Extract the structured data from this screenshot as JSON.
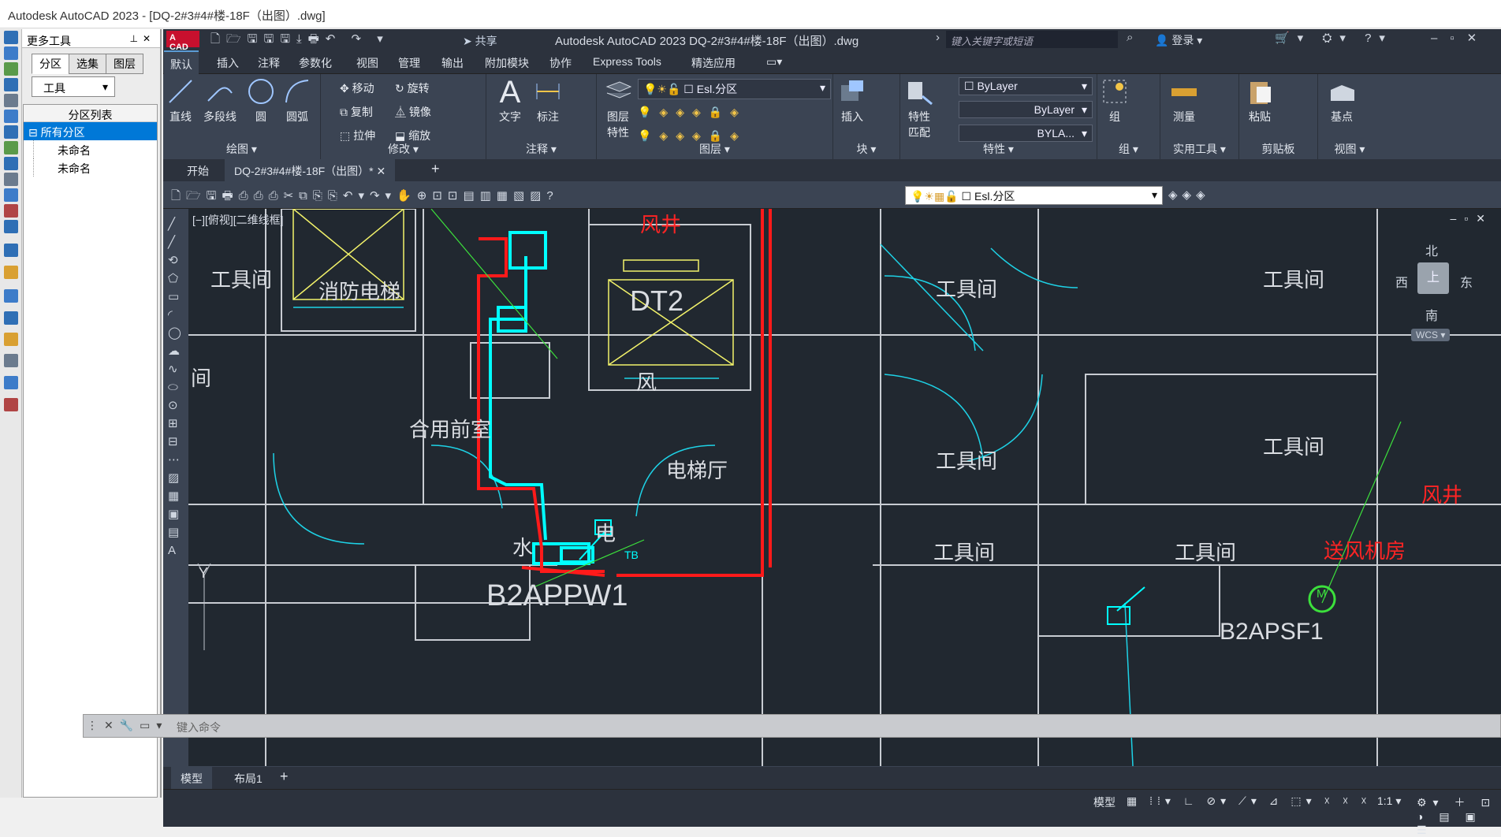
{
  "window": {
    "title": "Autodesk AutoCAD 2023 - [DQ-2#3#4#楼-18F（出图）.dwg]"
  },
  "palette": {
    "title": "更多工具",
    "tabs": [
      "分区",
      "选集",
      "图层"
    ],
    "dropdown": "工具",
    "list_header": "分区列表",
    "items": [
      "所有分区",
      "未命名",
      "未命名"
    ]
  },
  "qat": {
    "logo": "A CAD",
    "share": "共享",
    "title": "Autodesk AutoCAD 2023    DQ-2#3#4#楼-18F（出图）.dwg",
    "search_placeholder": "键入关键字或短语",
    "login": "登录"
  },
  "ribbon_tabs": [
    "默认",
    "插入",
    "注释",
    "参数化",
    "视图",
    "管理",
    "输出",
    "附加模块",
    "协作",
    "Express Tools",
    "精选应用"
  ],
  "ribbon": {
    "draw": {
      "label": "绘图",
      "items": [
        "直线",
        "多段线",
        "圆",
        "圆弧"
      ]
    },
    "modify": {
      "label": "修改",
      "items": [
        "移动",
        "旋转",
        "复制",
        "镜像",
        "拉伸",
        "缩放"
      ]
    },
    "annotation": {
      "label": "注释",
      "items": [
        "文字",
        "标注"
      ]
    },
    "layers": {
      "label": "图层",
      "props": "图层\n特性",
      "current": "Esl.分区"
    },
    "block": {
      "label": "块",
      "insert": "插入"
    },
    "properties": {
      "label": "特性",
      "match": "特性\n匹配",
      "color": "ByLayer",
      "linetype": "ByLayer",
      "lineweight": "BYLA..."
    },
    "groups": {
      "label": "组",
      "group": "组"
    },
    "utilities": {
      "label": "实用工具",
      "measure": "测量"
    },
    "clipboard": {
      "label": "剪贴板",
      "paste": "粘贴"
    },
    "view": {
      "label": "视图",
      "base": "基点"
    }
  },
  "doc_tabs": [
    "开始",
    "DQ-2#3#4#楼-18F（出图）*"
  ],
  "layer_combo": "Esl.分区",
  "viewport_label": "[−][俯视][二维线框]",
  "nav": {
    "north": "北",
    "south": "南",
    "east": "东",
    "west": "西",
    "top": "上",
    "wcs": "WCS"
  },
  "drawing_texts": {
    "t1": "工具间",
    "t2": "消防电梯",
    "t3": "风井",
    "t4": "DT2",
    "t5": "工具间",
    "t6": "工具间",
    "t7": "间",
    "t8": "风",
    "t9": "合用前室",
    "t10": "电梯厅",
    "t11": "工具间",
    "t12": "工具间",
    "t13": "风井",
    "t14": "工具间",
    "t15": "水",
    "t16": "电",
    "t17": "TB",
    "t18": "工具间",
    "t19": "送风机房",
    "t20": "B2APPW1",
    "t21": "B2APSF1",
    "t22": "M",
    "y_axis": "Y"
  },
  "command": {
    "placeholder": "键入命令"
  },
  "layout_tabs": [
    "模型",
    "布局1"
  ],
  "status": {
    "model": "模型",
    "scale": "1:1"
  }
}
